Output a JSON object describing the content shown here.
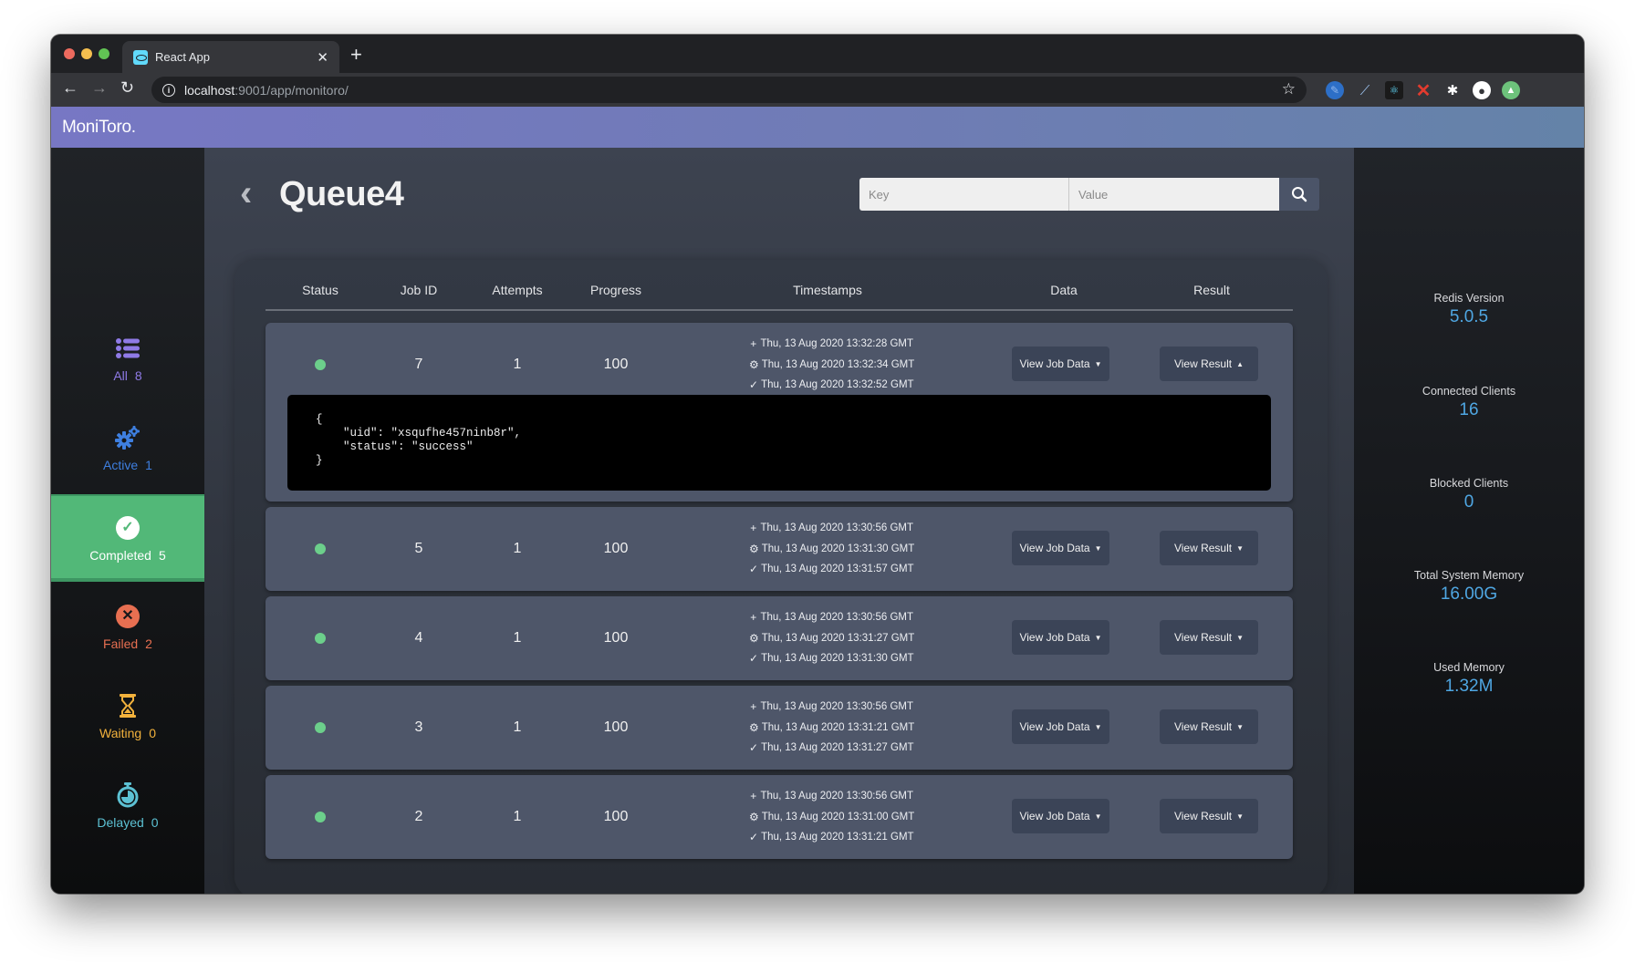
{
  "browser": {
    "tab_title": "React App",
    "url_host": "localhost",
    "url_rest": ":9001/app/monitoro/"
  },
  "app": {
    "brand": "MoniToro."
  },
  "sidebar": {
    "items": [
      {
        "key": "all",
        "label": "All",
        "count": "8",
        "icon": "list-icon",
        "color": "#8f7ae6"
      },
      {
        "key": "active",
        "label": "Active",
        "count": "1",
        "icon": "gears-icon",
        "color": "#3e7fe0"
      },
      {
        "key": "completed",
        "label": "Completed",
        "count": "5",
        "icon": "check-circle-icon",
        "color": "#52b878",
        "selected": true
      },
      {
        "key": "failed",
        "label": "Failed",
        "count": "2",
        "icon": "x-circle-icon",
        "color": "#e76f51"
      },
      {
        "key": "waiting",
        "label": "Waiting",
        "count": "0",
        "icon": "hourglass-icon",
        "color": "#f3b23c"
      },
      {
        "key": "delayed",
        "label": "Delayed",
        "count": "0",
        "icon": "stopwatch-icon",
        "color": "#5cc1d3"
      }
    ]
  },
  "main": {
    "title": "Queue4",
    "search": {
      "key_placeholder": "Key",
      "value_placeholder": "Value",
      "key_value": "",
      "value_value": ""
    },
    "table": {
      "columns": [
        "Status",
        "Job ID",
        "Attempts",
        "Progress",
        "Timestamps",
        "Data",
        "Result"
      ],
      "view_data_label": "View Job Data",
      "view_result_label": "View Result",
      "rows": [
        {
          "status": "completed",
          "job_id": "7",
          "attempts": "1",
          "progress": "100",
          "created": "Thu, 13 Aug 2020 13:32:28 GMT",
          "processed": "Thu, 13 Aug 2020 13:32:34 GMT",
          "finished": "Thu, 13 Aug 2020 13:32:52 GMT",
          "result_expanded": true,
          "result_text": "{\n    \"uid\": \"xsqufhe457ninb8r\",\n    \"status\": \"success\"\n}"
        },
        {
          "status": "completed",
          "job_id": "5",
          "attempts": "1",
          "progress": "100",
          "created": "Thu, 13 Aug 2020 13:30:56 GMT",
          "processed": "Thu, 13 Aug 2020 13:31:30 GMT",
          "finished": "Thu, 13 Aug 2020 13:31:57 GMT",
          "result_expanded": false
        },
        {
          "status": "completed",
          "job_id": "4",
          "attempts": "1",
          "progress": "100",
          "created": "Thu, 13 Aug 2020 13:30:56 GMT",
          "processed": "Thu, 13 Aug 2020 13:31:27 GMT",
          "finished": "Thu, 13 Aug 2020 13:31:30 GMT",
          "result_expanded": false
        },
        {
          "status": "completed",
          "job_id": "3",
          "attempts": "1",
          "progress": "100",
          "created": "Thu, 13 Aug 2020 13:30:56 GMT",
          "processed": "Thu, 13 Aug 2020 13:31:21 GMT",
          "finished": "Thu, 13 Aug 2020 13:31:27 GMT",
          "result_expanded": false
        },
        {
          "status": "completed",
          "job_id": "2",
          "attempts": "1",
          "progress": "100",
          "created": "Thu, 13 Aug 2020 13:30:56 GMT",
          "processed": "Thu, 13 Aug 2020 13:31:00 GMT",
          "finished": "Thu, 13 Aug 2020 13:31:21 GMT",
          "result_expanded": false
        }
      ]
    }
  },
  "stats": [
    {
      "label": "Redis Version",
      "value": "5.0.5"
    },
    {
      "label": "Connected Clients",
      "value": "16"
    },
    {
      "label": "Blocked Clients",
      "value": "0"
    },
    {
      "label": "Total System Memory",
      "value": "16.00G"
    },
    {
      "label": "Used Memory",
      "value": "1.32M"
    }
  ]
}
